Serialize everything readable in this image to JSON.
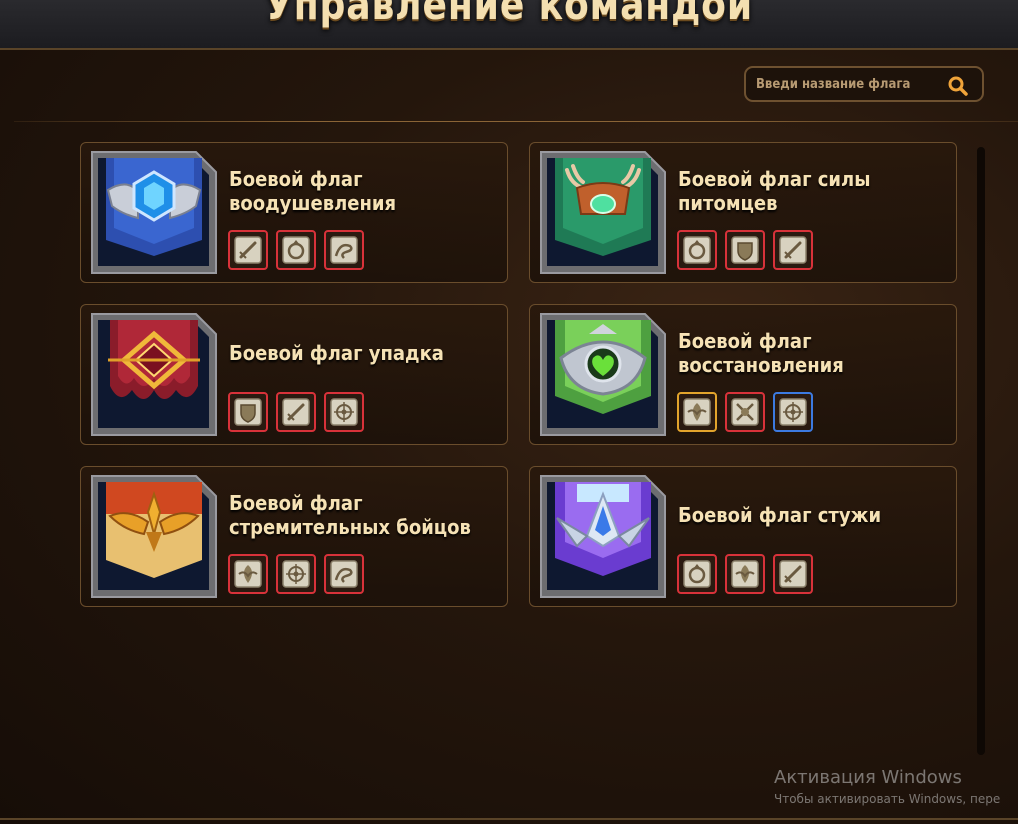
{
  "header": {
    "title": "Управление командой"
  },
  "search": {
    "placeholder": "Введи название флага",
    "icon": "search-icon"
  },
  "flags": [
    {
      "name": "Боевой флаг воодушевления",
      "title_lines": [
        "Боевой флаг",
        "воодушевления"
      ],
      "emblem": "blue-crystal-shield-emblem",
      "skills": [
        {
          "icon": "sword-scroll-icon",
          "rarity": "red"
        },
        {
          "icon": "swirl-arrow-scroll-icon",
          "rarity": "red"
        },
        {
          "icon": "wind-scroll-icon",
          "rarity": "red"
        }
      ]
    },
    {
      "name": "Боевой флаг силы питомцев",
      "title_lines": [
        "Боевой флаг силы",
        "питомцев"
      ],
      "emblem": "green-antler-emblem",
      "skills": [
        {
          "icon": "swirl-arrow-scroll-icon",
          "rarity": "red"
        },
        {
          "icon": "shield-scroll-icon",
          "rarity": "red"
        },
        {
          "icon": "sword-scroll-icon",
          "rarity": "red"
        }
      ]
    },
    {
      "name": "Боевой флаг упадка",
      "title_lines": [
        "Боевой флаг упадка"
      ],
      "emblem": "crimson-gold-diamond-emblem",
      "skills": [
        {
          "icon": "shield-scroll-icon",
          "rarity": "red"
        },
        {
          "icon": "sword-scroll-icon",
          "rarity": "red"
        },
        {
          "icon": "target-scroll-icon",
          "rarity": "red"
        }
      ]
    },
    {
      "name": "Боевой флаг восстановления",
      "title_lines": [
        "Боевой флаг",
        "восстановления"
      ],
      "emblem": "green-heart-emblem",
      "skills": [
        {
          "icon": "leaf-scroll-icon",
          "rarity": "gold"
        },
        {
          "icon": "cross-arrows-scroll-icon",
          "rarity": "red"
        },
        {
          "icon": "target-scroll-icon",
          "rarity": "blue"
        }
      ]
    },
    {
      "name": "Боевой флаг стремительных бойцов",
      "title_lines": [
        "Боевой флаг",
        "стремительных бойцов"
      ],
      "emblem": "gold-wings-emblem",
      "skills": [
        {
          "icon": "leaf-scroll-icon",
          "rarity": "red"
        },
        {
          "icon": "target-scroll-icon",
          "rarity": "red"
        },
        {
          "icon": "wind-scroll-icon",
          "rarity": "red"
        }
      ]
    },
    {
      "name": "Боевой флаг стужи",
      "title_lines": [
        "Боевой флаг стужи"
      ],
      "emblem": "purple-ice-emblem",
      "skills": [
        {
          "icon": "swirl-arrow-scroll-icon",
          "rarity": "red"
        },
        {
          "icon": "leaf-scroll-icon",
          "rarity": "red"
        },
        {
          "icon": "sword-scroll-icon",
          "rarity": "red"
        }
      ]
    }
  ],
  "colors": {
    "rarity_red": "#d8323a",
    "rarity_gold": "#e2a42c",
    "rarity_blue": "#3c7ae0",
    "title": "#f6e2b5"
  },
  "watermark": {
    "title": "Активация Windows",
    "subtitle": "Чтобы активировать Windows, пере"
  }
}
